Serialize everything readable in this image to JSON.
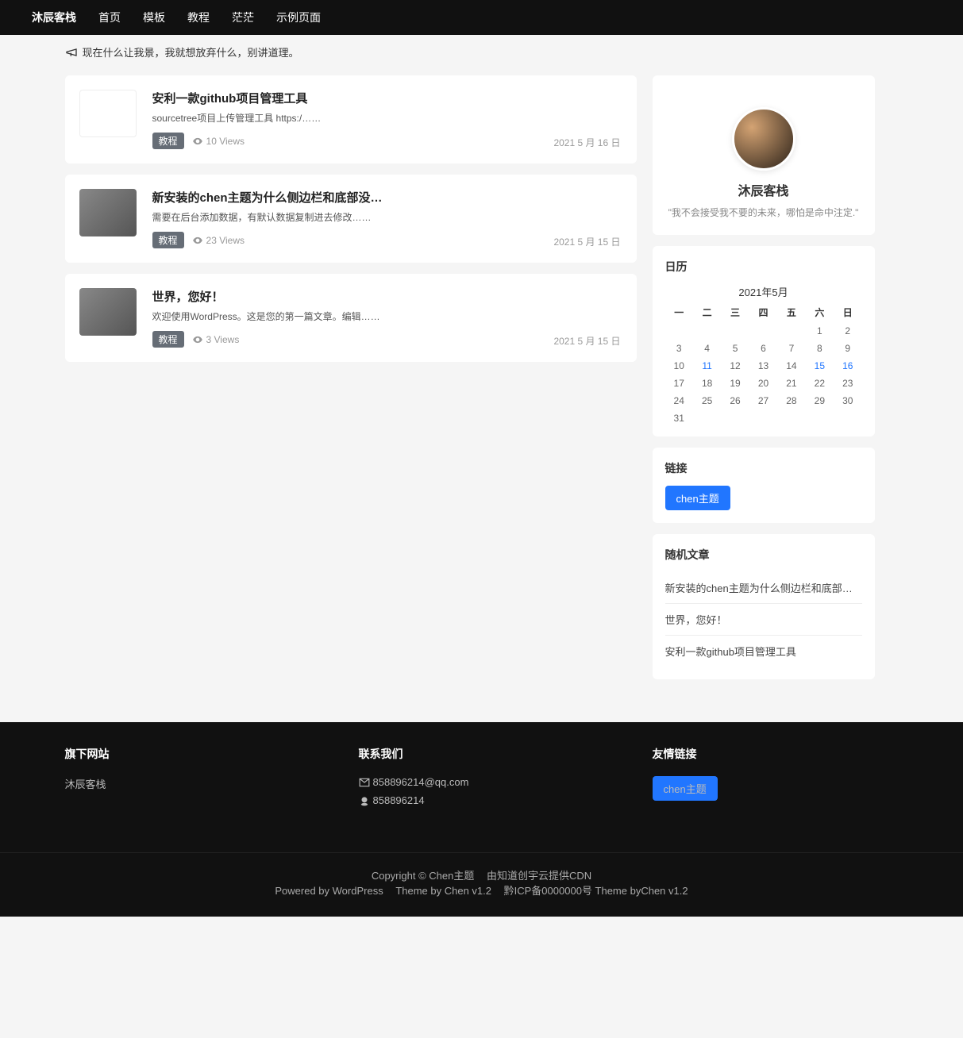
{
  "nav": {
    "brand": "沐辰客栈",
    "items": [
      "首页",
      "模板",
      "教程",
      "茫茫",
      "示例页面"
    ]
  },
  "announcement": "现在什么让我景，我就想放弃什么，别讲道理。",
  "posts": [
    {
      "title": "安利一款github项目管理工具",
      "excerpt": "sourcetree项目上传管理工具 https:/……",
      "tag": "教程",
      "views": "10 Views",
      "date": "2021 5 月 16 日"
    },
    {
      "title": "新安装的chen主题为什么侧边栏和底部没…",
      "excerpt": "需要在后台添加数据，有默认数据复制进去修改……",
      "tag": "教程",
      "views": "23 Views",
      "date": "2021 5 月 15 日"
    },
    {
      "title": "世界，您好！",
      "excerpt": "欢迎使用WordPress。这是您的第一篇文章。编辑……",
      "tag": "教程",
      "views": "3 Views",
      "date": "2021 5 月 15 日"
    }
  ],
  "profile": {
    "name": "沐辰客栈",
    "motto": "\"我不会接受我不要的未来，哪怕是命中注定.\""
  },
  "calendar": {
    "heading": "日历",
    "caption": "2021年5月",
    "weekdays": [
      "一",
      "二",
      "三",
      "四",
      "五",
      "六",
      "日"
    ],
    "leading_blanks": 5,
    "days": 31,
    "linked_days": [
      11,
      15,
      16
    ]
  },
  "links": {
    "heading": "链接",
    "items": [
      {
        "label": "chen主题"
      }
    ]
  },
  "random": {
    "heading": "随机文章",
    "items": [
      "新安装的chen主题为什么侧边栏和底部没…",
      "世界，您好！",
      "安利一款github项目管理工具"
    ]
  },
  "footer": {
    "col1": {
      "heading": "旗下网站",
      "items": [
        "沐辰客栈"
      ]
    },
    "col2": {
      "heading": "联系我们",
      "email": "858896214@qq.com",
      "qq": "858896214"
    },
    "col3": {
      "heading": "友情链接",
      "items": [
        {
          "label": "chen主题"
        }
      ]
    },
    "bottom": {
      "line1_a": "Copyright © Chen主题",
      "line1_b": "由知道创宇云提供CDN",
      "line2_a": "Powered by WordPress",
      "line2_b": "Theme by Chen v1.2",
      "line2_c": "黔ICP备0000000号 Theme byChen v1.2"
    }
  }
}
